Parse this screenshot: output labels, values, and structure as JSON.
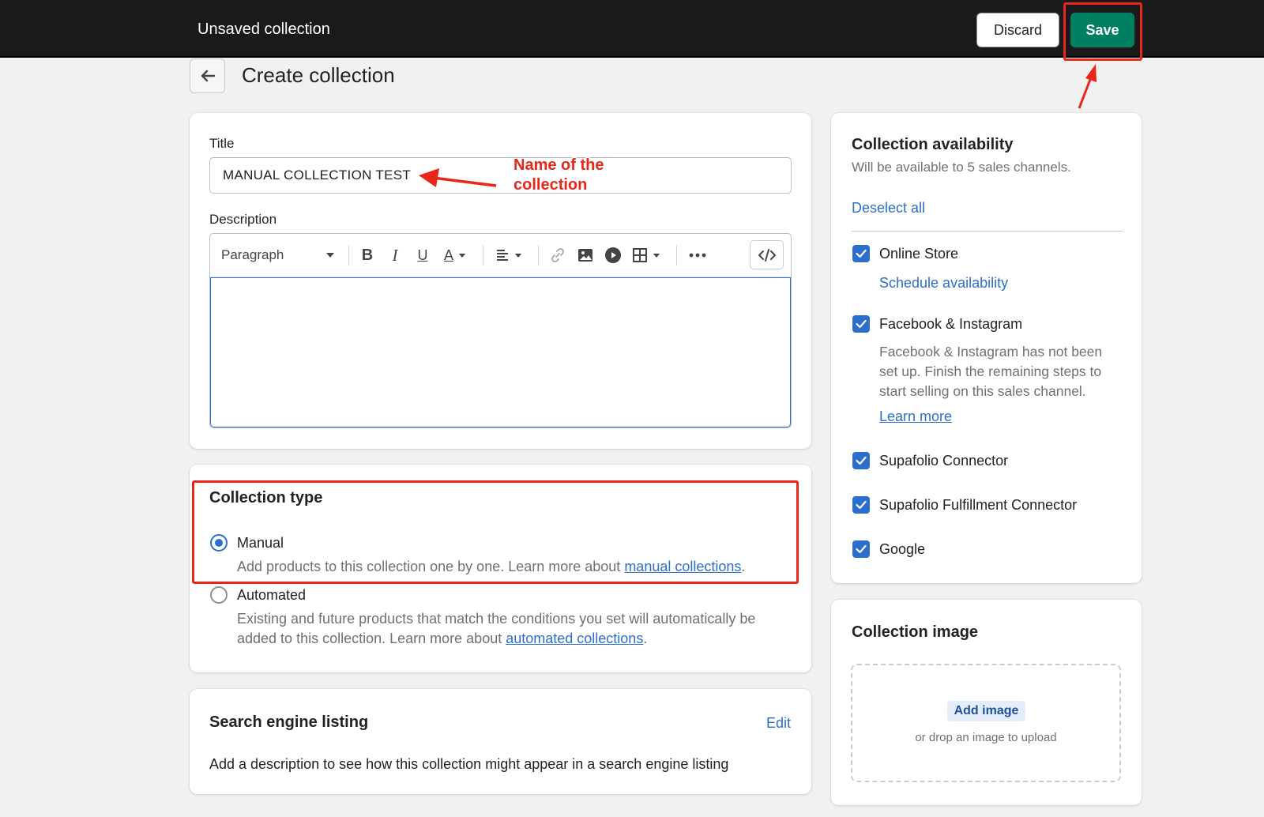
{
  "topbar": {
    "title": "Unsaved collection",
    "discard_label": "Discard",
    "save_label": "Save"
  },
  "page": {
    "title": "Create collection"
  },
  "main": {
    "title_label": "Title",
    "title_value": "MANUAL COLLECTION TEST",
    "description_label": "Description",
    "editor_toolbar": {
      "paragraph_label": "Paragraph",
      "bold": "B",
      "italic": "I",
      "underline": "U",
      "text_color": "A"
    }
  },
  "collection_type": {
    "title": "Collection type",
    "manual_label": "Manual",
    "manual_help_prefix": "Add products to this collection one by one. Learn more about ",
    "manual_help_link": "manual collections",
    "manual_help_suffix": ".",
    "automated_label": "Automated",
    "automated_help_prefix": "Existing and future products that match the conditions you set will automatically be added to this collection. Learn more about ",
    "automated_help_link": "automated collections",
    "automated_help_suffix": ".",
    "selected": "Manual"
  },
  "seo": {
    "title": "Search engine listing",
    "edit_label": "Edit",
    "description": "Add a description to see how this collection might appear in a search engine listing"
  },
  "availability": {
    "title": "Collection availability",
    "subtitle": "Will be available to 5 sales channels.",
    "deselect_all": "Deselect all",
    "channels": [
      {
        "label": "Online Store",
        "checked": true
      },
      {
        "label": "Facebook & Instagram",
        "checked": true
      },
      {
        "label": "Supafolio Connector",
        "checked": true
      },
      {
        "label": "Supafolio Fulfillment Connector",
        "checked": true
      },
      {
        "label": "Google",
        "checked": true
      }
    ],
    "schedule_label": "Schedule availability",
    "fb_note": "Facebook & Instagram has not been set up. Finish the remaining steps to start selling on this sales channel.",
    "learn_more": "Learn more"
  },
  "collection_image": {
    "title": "Collection image",
    "add_image": "Add image",
    "drop_hint": "or drop an image to upload"
  },
  "annotation": {
    "text_line1": "Name of the",
    "text_line2": "collection"
  },
  "colors": {
    "topbar": "#1a1a1a",
    "primary": "#008060",
    "link": "#2c6ecb",
    "annotation": "#e8261a"
  }
}
